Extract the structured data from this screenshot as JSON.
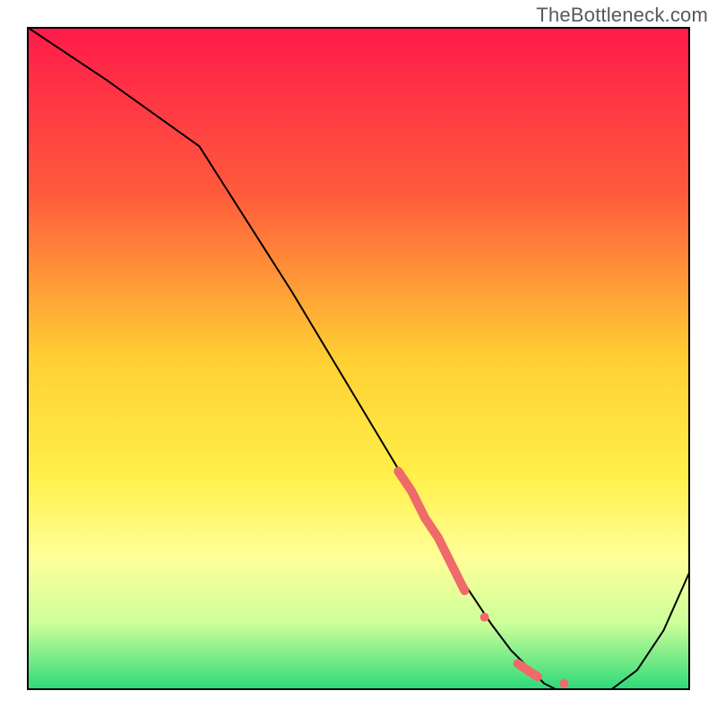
{
  "watermark": "TheBottleneck.com",
  "chart_data": {
    "type": "line",
    "title": "",
    "xlabel": "",
    "ylabel": "",
    "xlim": [
      0,
      100
    ],
    "ylim": [
      0,
      100
    ],
    "background_gradient": {
      "stops": [
        {
          "pos": 0.0,
          "color": "#ff1a4b"
        },
        {
          "pos": 0.25,
          "color": "#ff5a3c"
        },
        {
          "pos": 0.5,
          "color": "#ffcf33"
        },
        {
          "pos": 0.68,
          "color": "#fff04a"
        },
        {
          "pos": 0.8,
          "color": "#ffff99"
        },
        {
          "pos": 0.9,
          "color": "#ccff99"
        },
        {
          "pos": 1.0,
          "color": "#2bd978"
        }
      ]
    },
    "series": [
      {
        "name": "bottleneck-curve",
        "color": "#000000",
        "width": 2,
        "x": [
          0,
          12,
          26,
          40,
          52,
          58,
          62,
          66,
          70,
          73,
          76,
          78,
          80,
          82,
          85,
          88,
          92,
          96,
          100
        ],
        "y": [
          100,
          92,
          82,
          60,
          40,
          30,
          23,
          16,
          10,
          6,
          3,
          1,
          0,
          0,
          0,
          0,
          3,
          9,
          18
        ]
      }
    ],
    "markers": [
      {
        "name": "dense-segment",
        "render": "thick-stroke",
        "color": "#ef6a6a",
        "width": 10,
        "x": [
          56,
          58,
          60,
          62,
          64,
          66
        ],
        "y": [
          33,
          30,
          26,
          23,
          19,
          15
        ]
      },
      {
        "name": "dot-1",
        "render": "circle",
        "color": "#ef6a6a",
        "r": 5,
        "x": 69,
        "y": 11
      },
      {
        "name": "dot-cluster-lower",
        "render": "thick-stroke",
        "color": "#ef6a6a",
        "width": 10,
        "x": [
          74,
          77
        ],
        "y": [
          4,
          2
        ]
      },
      {
        "name": "dot-2",
        "render": "circle",
        "color": "#ef6a6a",
        "r": 5,
        "x": 81,
        "y": 1
      }
    ]
  }
}
